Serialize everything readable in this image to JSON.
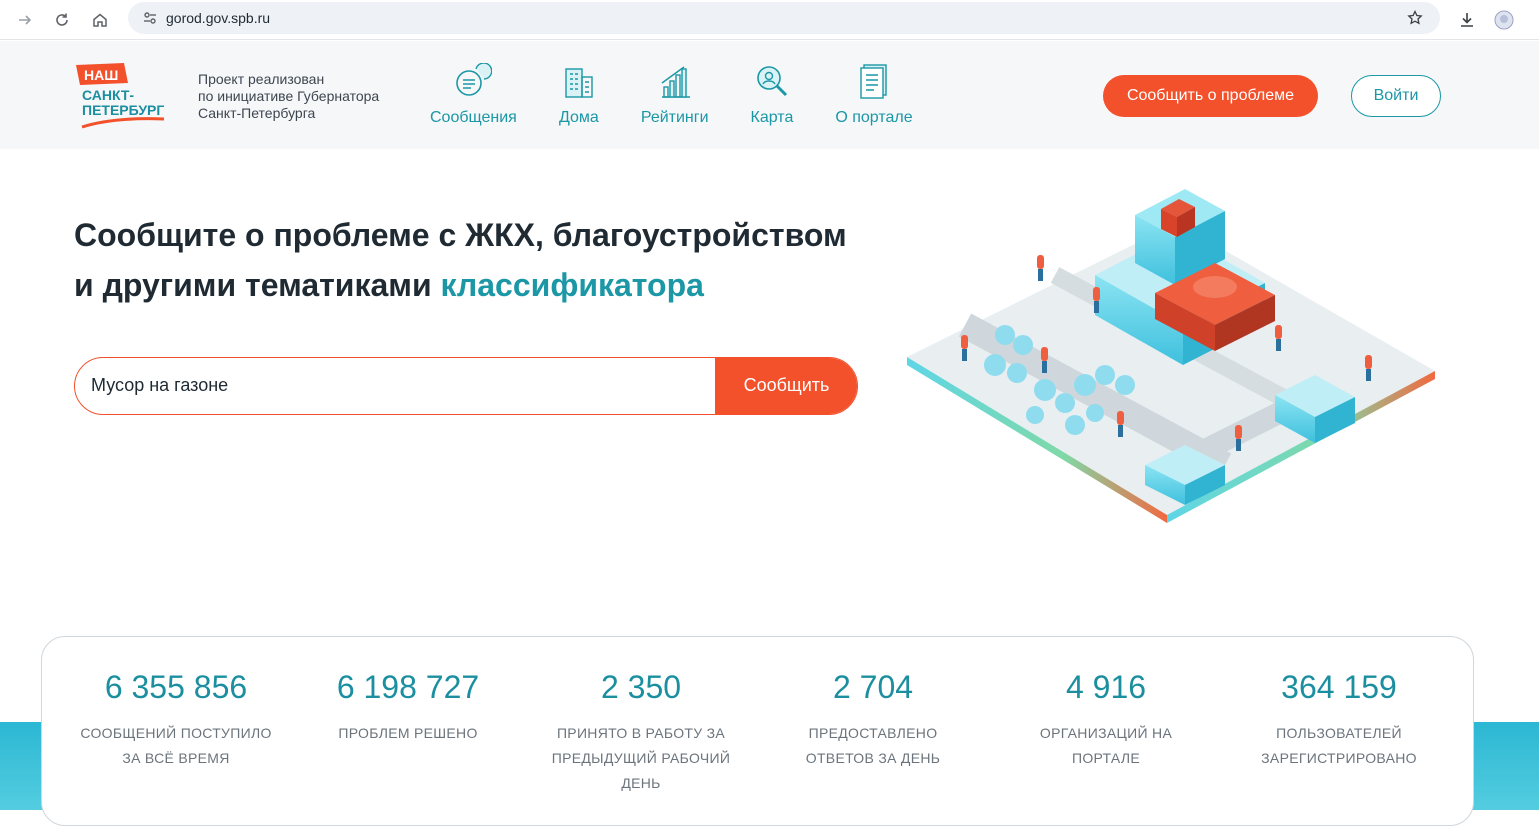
{
  "browser": {
    "url": "gorod.gov.spb.ru"
  },
  "header": {
    "logo": {
      "line1": "НАШ",
      "line2": "САНКТ-",
      "line3": "ПЕТЕРБУРГ"
    },
    "project_lines": [
      "Проект реализован",
      "по инициативе Губернатора",
      "Санкт-Петербурга"
    ],
    "nav": [
      {
        "label": "Сообщения",
        "icon": "messages-icon"
      },
      {
        "label": "Дома",
        "icon": "building-icon"
      },
      {
        "label": "Рейтинги",
        "icon": "ratings-icon"
      },
      {
        "label": "Карта",
        "icon": "map-search-icon"
      },
      {
        "label": "О портале",
        "icon": "document-icon"
      }
    ],
    "report_button": "Сообщить о проблеме",
    "login_button": "Войти"
  },
  "hero": {
    "title_part1": "Сообщите о проблеме с ЖКХ, благоустройством",
    "title_part2": "и другими тематиками ",
    "title_accent": "классификатора",
    "search_value": "Мусор на газоне",
    "search_button": "Сообщить"
  },
  "stats": [
    {
      "value": "6 355 856",
      "label_lines": [
        "СООБЩЕНИЙ ПОСТУПИЛО",
        "ЗА ВСЁ ВРЕМЯ"
      ]
    },
    {
      "value": "6 198 727",
      "label_lines": [
        "ПРОБЛЕМ РЕШЕНО"
      ]
    },
    {
      "value": "2 350",
      "label_lines": [
        "ПРИНЯТО В РАБОТУ ЗА",
        "ПРЕДЫДУЩИЙ РАБОЧИЙ",
        "ДЕНЬ"
      ]
    },
    {
      "value": "2 704",
      "label_lines": [
        "ПРЕДОСТАВЛЕНО",
        "ОТВЕТОВ ЗА ДЕНЬ"
      ]
    },
    {
      "value": "4 916",
      "label_lines": [
        "ОРГАНИЗАЦИЙ НА",
        "ПОРТАЛЕ"
      ]
    },
    {
      "value": "364 159",
      "label_lines": [
        "ПОЛЬЗОВАТЕЛЕЙ",
        "ЗАРЕГИСТРИРОВАНО"
      ]
    }
  ],
  "colors": {
    "accent_orange": "#f2512b",
    "accent_teal": "#1b97a6"
  }
}
